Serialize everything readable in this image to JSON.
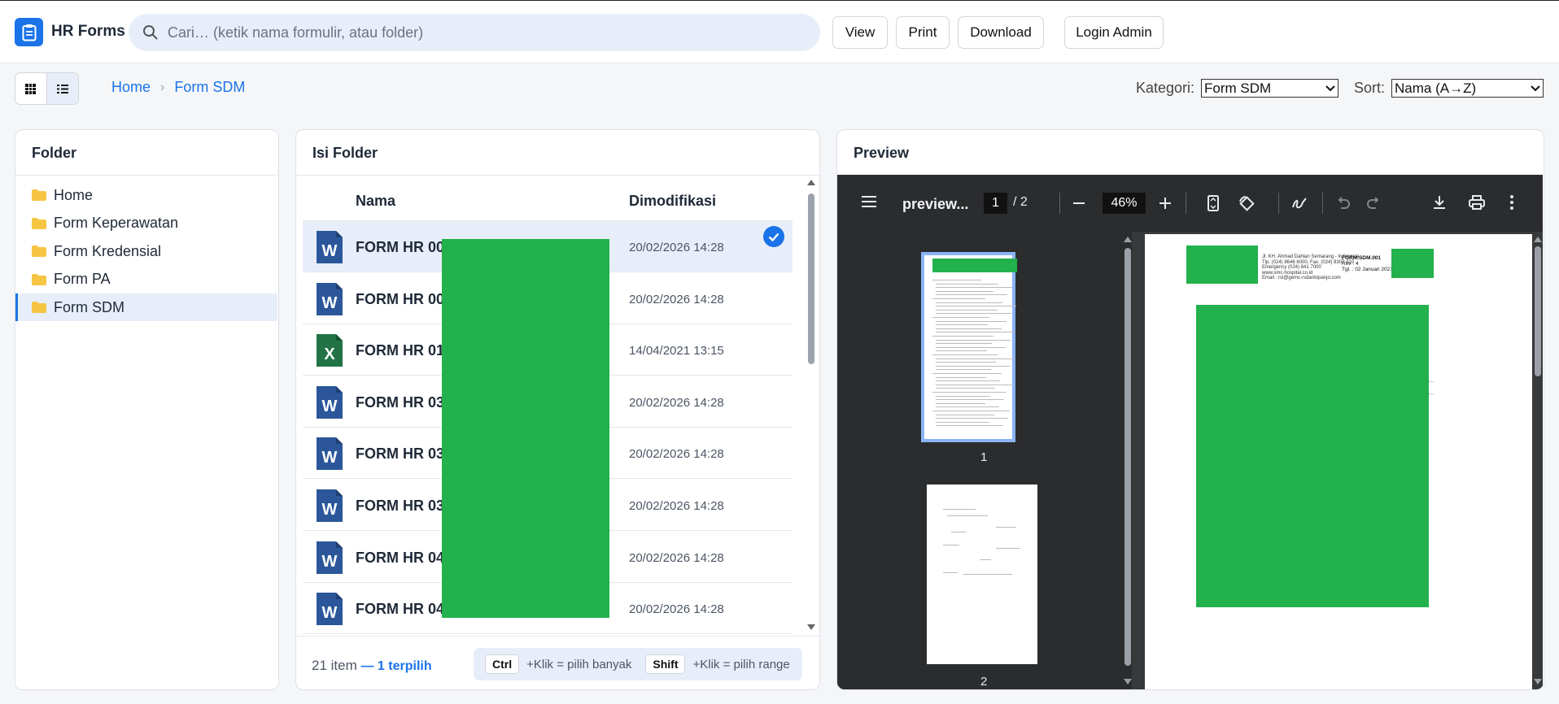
{
  "app": {
    "title": "HR Forms",
    "logo_icon": "clipboard-icon",
    "accent": "#1a73e8"
  },
  "search": {
    "placeholder": "Cari… (ketik nama formulir, atau folder)"
  },
  "toolbar": {
    "view": "View",
    "print": "Print",
    "download": "Download",
    "login": "Login Admin"
  },
  "breadcrumb": {
    "home": "Home",
    "current": "Form SDM"
  },
  "filters": {
    "kategori_label": "Kategori:",
    "kategori_value": "Form SDM",
    "sort_label": "Sort:",
    "sort_value": "Nama (A→Z)"
  },
  "folders": {
    "title": "Folder",
    "items": [
      {
        "label": "Home",
        "active": false
      },
      {
        "label": "Form Keperawatan",
        "active": false
      },
      {
        "label": "Form Kredensial",
        "active": false
      },
      {
        "label": "Form PA",
        "active": false
      },
      {
        "label": "Form SDM",
        "active": true
      }
    ]
  },
  "contents": {
    "title": "Isi Folder",
    "col_name": "Nama",
    "col_modified": "Dimodifikasi",
    "rows": [
      {
        "name": "FORM HR 001",
        "modified": "20/02/2026 14:28",
        "type": "word",
        "selected": true
      },
      {
        "name": "FORM HR 002",
        "modified": "20/02/2026 14:28",
        "type": "word",
        "selected": false
      },
      {
        "name": "FORM HR 010",
        "modified": "14/04/2021 13:15",
        "type": "excel",
        "selected": false
      },
      {
        "name": "FORM HR 030",
        "modified": "20/02/2026 14:28",
        "type": "word",
        "selected": false
      },
      {
        "name": "FORM HR 031",
        "modified": "20/02/2026 14:28",
        "type": "word",
        "selected": false
      },
      {
        "name": "FORM HR 037",
        "modified": "20/02/2026 14:28",
        "type": "word",
        "selected": false
      },
      {
        "name": "FORM HR 040",
        "modified": "20/02/2026 14:28",
        "type": "word",
        "selected": false
      },
      {
        "name": "FORM HR 043",
        "modified": "20/02/2026 14:28",
        "type": "word",
        "selected": false
      }
    ],
    "count": "21 item",
    "selected_count": "— 1 terpilih",
    "hint_ctrl_key": "Ctrl",
    "hint_ctrl_text": "+Klik = pilih banyak",
    "hint_shift_key": "Shift",
    "hint_shift_text": "+Klik = pilih range"
  },
  "preview": {
    "title": "Preview",
    "file_title": "preview...",
    "page_current": "1",
    "page_total": "/ 2",
    "zoom": "46%",
    "thumb_labels": [
      "1",
      "2"
    ],
    "doc_header": {
      "address_lines": [
        "Jl. KH. Ahmad Dahlan Semarang - Indonesia",
        "Tlp. (024) 8646 6000, Fax. (024) 8307 410",
        "Emergency (024) 841 7000",
        "www.smc-hospital.co.id",
        "Email : rsl@gemc-rsdantopanjo.com"
      ],
      "form_code": "FORM.SDM.001",
      "rev": "Rev  :  4",
      "date": "Tgl.   : 02 Januari 2021"
    },
    "redaction_color": "#22b14c"
  }
}
